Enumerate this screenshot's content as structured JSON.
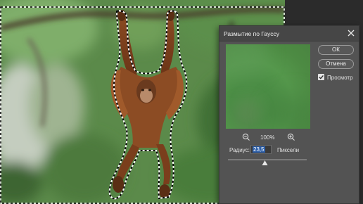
{
  "dialog": {
    "title": "Размытие по Гауссу",
    "ok_label": "ОК",
    "cancel_label": "Отмена",
    "preview_checkbox_label": "Просмотр",
    "preview_checked": true,
    "zoom_level": "100%",
    "radius_label": "Радиус:",
    "radius_value": "23,5",
    "radius_unit": "Пиксели",
    "slider_position": 0.47
  },
  "colors": {
    "dialog_bg": "#535353",
    "titlebar_bg": "#464646",
    "input_highlight": "#2d5fa8",
    "workspace_bg": "#282828"
  },
  "icons": {
    "close": "close-icon",
    "zoom_out": "zoom-out-icon",
    "zoom_in": "zoom-in-icon",
    "checkbox": "checkmark-icon",
    "slider": "slider-triangle-icon"
  }
}
